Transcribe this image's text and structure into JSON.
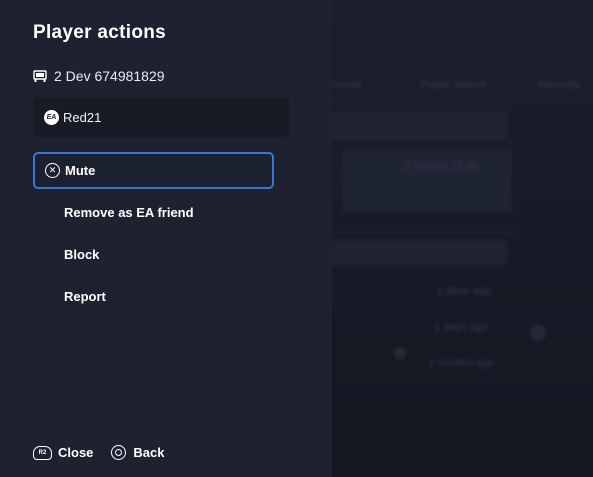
{
  "panel": {
    "title": "Player actions",
    "platform_icon": "car-console-icon",
    "platform_label": "2 Dev 674981829",
    "user": {
      "badge_text": "EA",
      "name": "Red21"
    },
    "actions": [
      {
        "label": "Mute",
        "selected": true,
        "icon": "x-circle-icon"
      },
      {
        "label": "Remove as EA friend",
        "selected": false
      },
      {
        "label": "Block",
        "selected": false
      },
      {
        "label": "Report",
        "selected": false
      }
    ],
    "footer": {
      "close_button_glyph": "R2",
      "close_label": "Close",
      "back_label": "Back"
    }
  },
  "background": {
    "headers": [
      "ments",
      "Player search",
      "Recently"
    ],
    "notice": "2 Guests 12 on",
    "times": [
      "1 days ago",
      "1 days ago",
      "1 months ago"
    ]
  },
  "colors": {
    "panel_bg": "#1e2230",
    "card_bg": "#181b26",
    "focus_border": "#3b74d6",
    "background": "#1b1f2c"
  }
}
